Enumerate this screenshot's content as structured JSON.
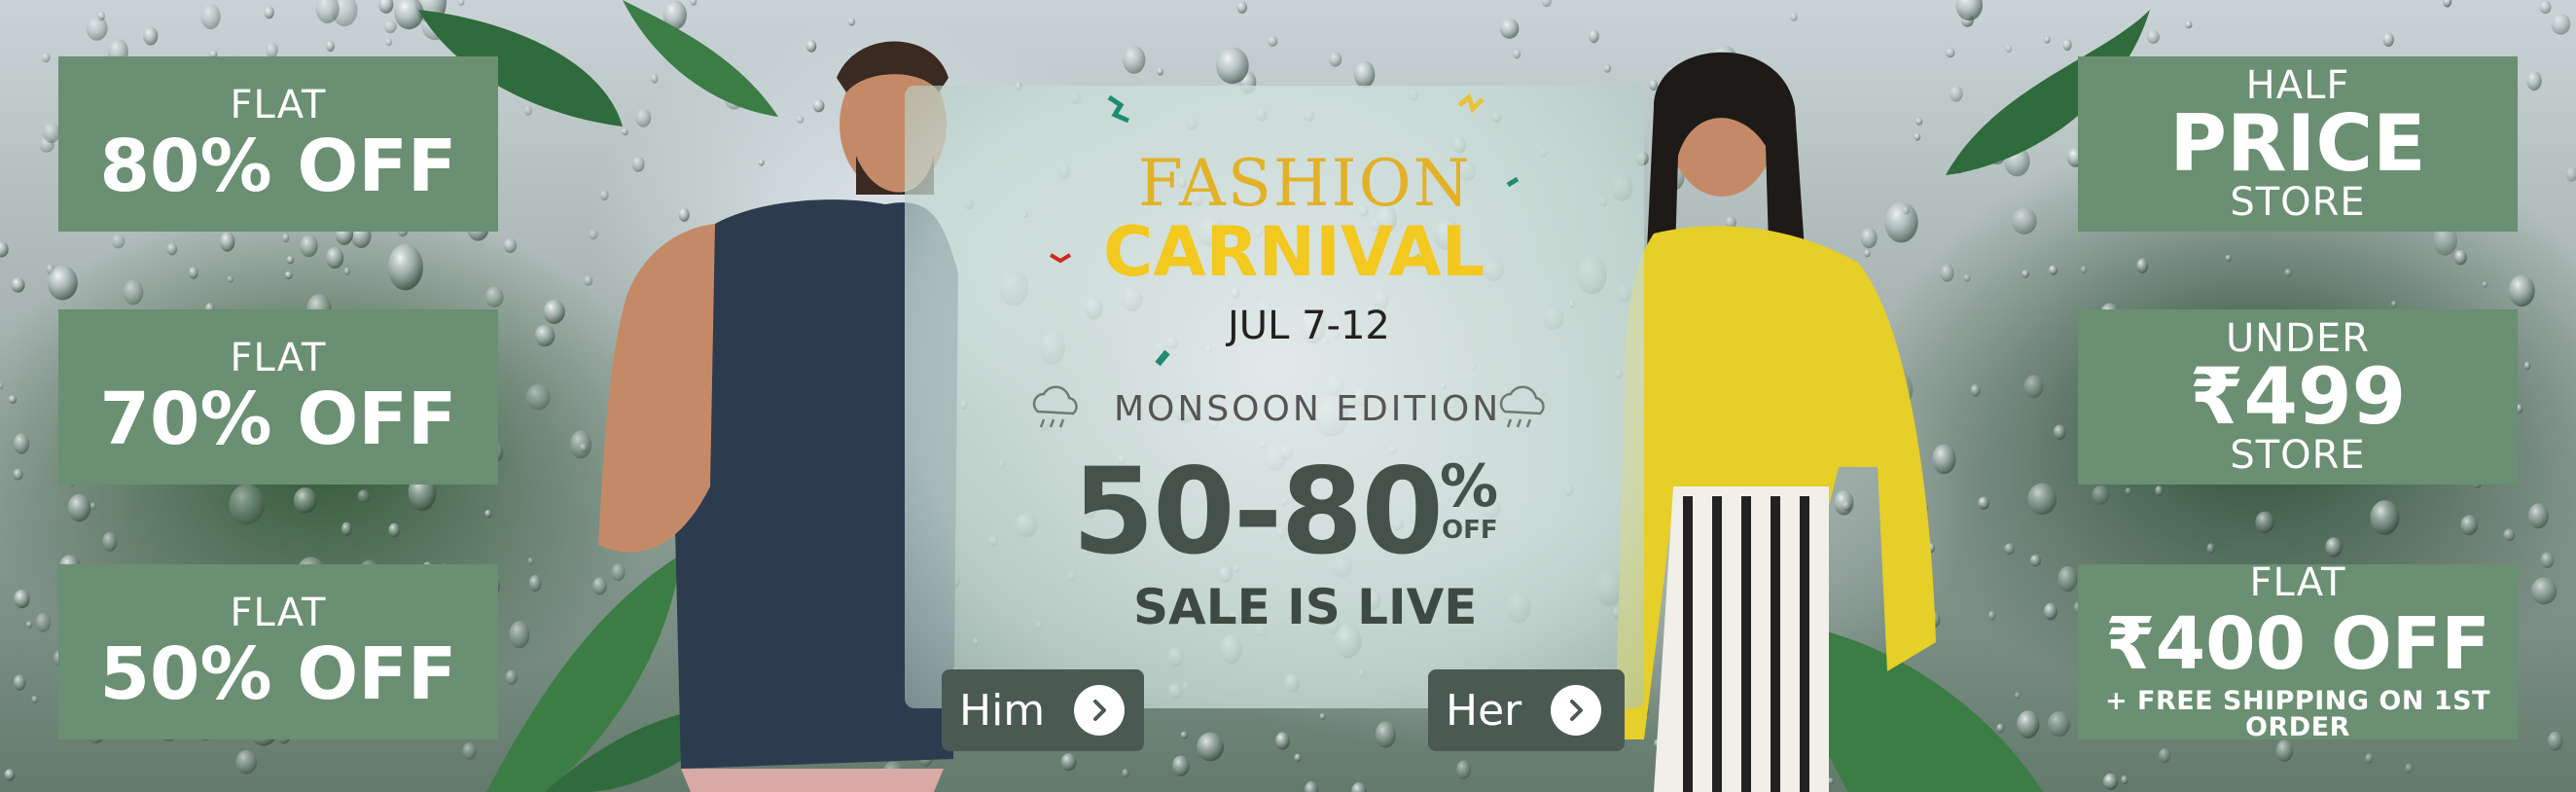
{
  "left_tiles": [
    {
      "small": "FLAT",
      "large": "80% OFF"
    },
    {
      "small": "FLAT",
      "large": "70% OFF"
    },
    {
      "small": "FLAT",
      "large": "50% OFF"
    }
  ],
  "right_tiles": [
    {
      "top": "HALF",
      "large": "PRICE",
      "bottom": "STORE"
    },
    {
      "top": "UNDER",
      "large": "₹499",
      "bottom": "STORE"
    },
    {
      "top": "FLAT",
      "large": "₹400 OFF",
      "fine": "+ FREE SHIPPING ON 1ST ORDER"
    }
  ],
  "center": {
    "title_line1": "FASHION",
    "title_line2": "CARNIVAL",
    "dates": "JUL 7-12",
    "edition": "MONSOON EDITION",
    "discount": "50-80",
    "percent_sign": "%",
    "off": "OFF",
    "sale_status": "SALE IS LIVE"
  },
  "buttons": {
    "him": "Him",
    "her": "Her"
  },
  "colors": {
    "tile_bg": "#6a8f72",
    "title_gold": "#f3c81f",
    "discount_text": "#45524b",
    "button_bg": "#4a5a52"
  }
}
